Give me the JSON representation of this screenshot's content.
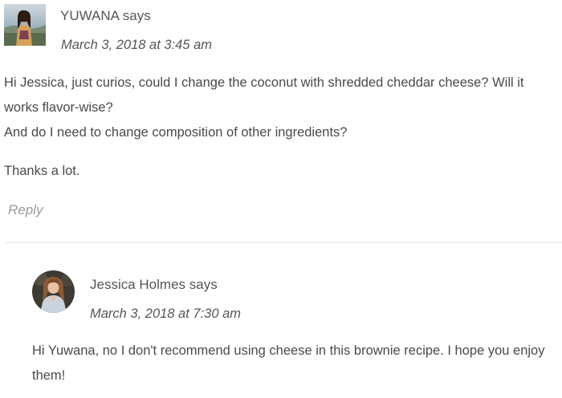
{
  "comments": [
    {
      "author": "YUWANA",
      "says": "says",
      "date": "March 3, 2018 at 3:45 am",
      "paragraphs": [
        "Hi Jessica, just curios, could I change the coconut with shredded cheddar cheese? Will it works flavor-wise?",
        "And do I need to change composition of other ingredients?",
        "Thanks a lot."
      ],
      "reply_label": "Reply",
      "avatar_icon": "user-photo-avatar"
    },
    {
      "author": "Jessica Holmes",
      "says": "says",
      "date": "March 3, 2018 at 7:30 am",
      "paragraphs": [
        "Hi Yuwana, no I don't recommend using cheese in this brownie recipe. I hope you enjoy them!"
      ],
      "avatar_icon": "user-photo-avatar"
    }
  ],
  "colors": {
    "text": "#4a4a4a",
    "meta": "#555555",
    "reply": "#9a9a9a",
    "divider": "#e8e8e8"
  }
}
